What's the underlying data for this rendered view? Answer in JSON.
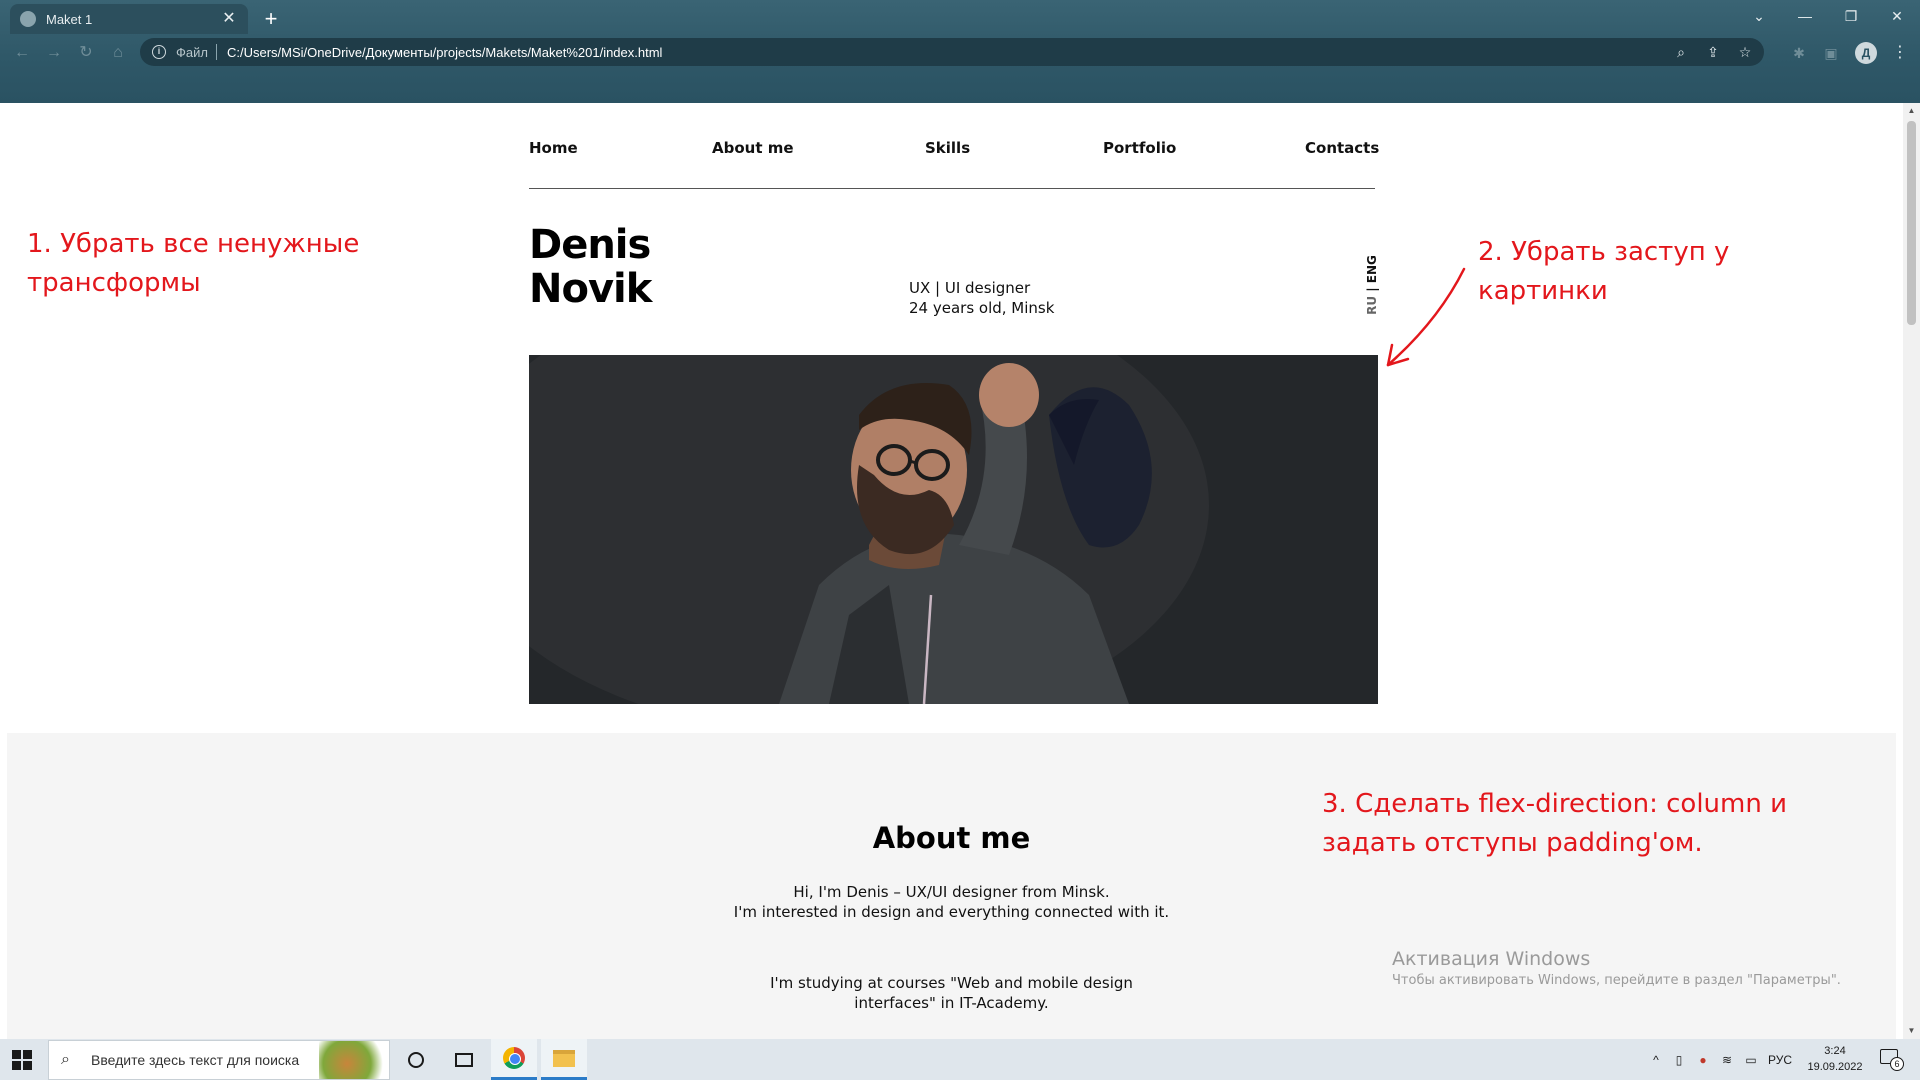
{
  "browser": {
    "tab_title": "Maket 1",
    "tab_close": "✕",
    "new_tab": "+",
    "url_scheme": "Файл",
    "url": "C:/Users/MSi/OneDrive/Документы/projects/Makets/Maket%201/index.html",
    "profile_initial": "Д",
    "window_controls": [
      "⌄",
      "—",
      "❐",
      "✕"
    ]
  },
  "site": {
    "nav": [
      "Home",
      "About me",
      "Skills",
      "Portfolio",
      "Contacts"
    ],
    "name_first": "Denis",
    "name_last": "Novik",
    "role": "UX | UI designer",
    "age_city": "24 years old, Minsk",
    "lang_ru": "RU",
    "lang_sep": " | ",
    "lang_eng": "ENG",
    "about": {
      "title": "About me",
      "p1_line1": "Hi, I'm Denis – UX/UI designer from Minsk.",
      "p1_line2": "I'm interested in design and everything connected with it.",
      "p2_line1": "I'm studying at courses \"Web and mobile design",
      "p2_line2": "interfaces\" in IT-Academy."
    }
  },
  "annotations": {
    "a1_line1": "1. Убрать все ненужные",
    "a1_line2": "трансформы",
    "a2_line1": "2. Убрать заступ у",
    "a2_line2": "картинки",
    "a3_line1": "3. Сделать flex-direction: column и",
    "a3_line2": "задать отступы padding'ом.",
    "color": "#e3171c"
  },
  "watermark": {
    "title": "Активация Windows",
    "subtitle": "Чтобы активировать Windows, перейдите в раздел \"Параметры\"."
  },
  "taskbar": {
    "search_placeholder": "Введите здесь текст для поиска",
    "lang": "РУС",
    "time": "3:24",
    "date": "19.09.2022",
    "notifications": "6"
  }
}
